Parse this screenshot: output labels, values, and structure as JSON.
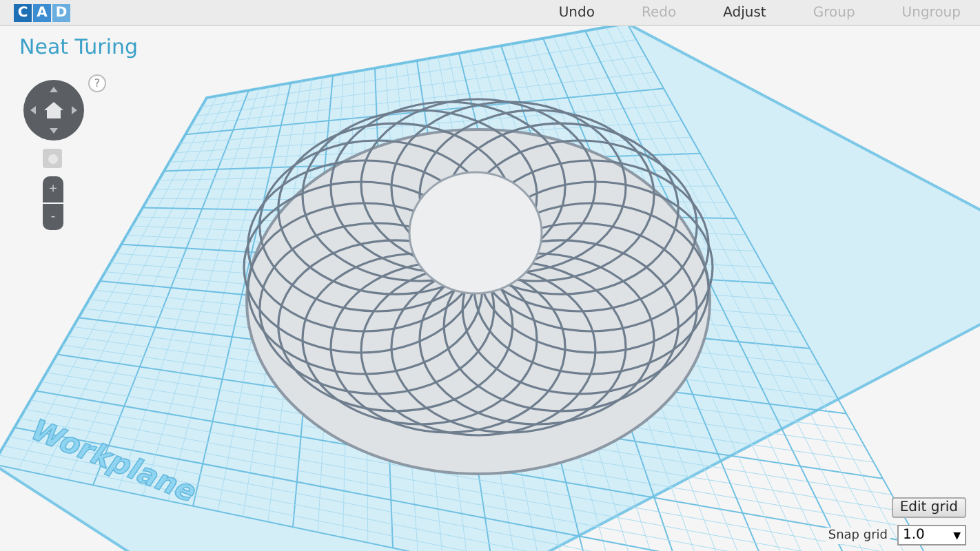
{
  "logo": {
    "letters": [
      "C",
      "A",
      "D"
    ]
  },
  "toolbar": [
    {
      "label": "Undo",
      "disabled": false
    },
    {
      "label": "Redo",
      "disabled": true
    },
    {
      "label": "Adjust",
      "disabled": false
    },
    {
      "label": "Group",
      "disabled": true
    },
    {
      "label": "Ungroup",
      "disabled": true
    }
  ],
  "design_title": "Neat Turing",
  "help": "?",
  "zoom": {
    "plus": "+",
    "minus": "-"
  },
  "workplane_label": "Workplane",
  "edit_grid": "Edit grid",
  "snap_grid": {
    "label": "Snap grid",
    "value": "1.0",
    "arrow": "▼"
  }
}
